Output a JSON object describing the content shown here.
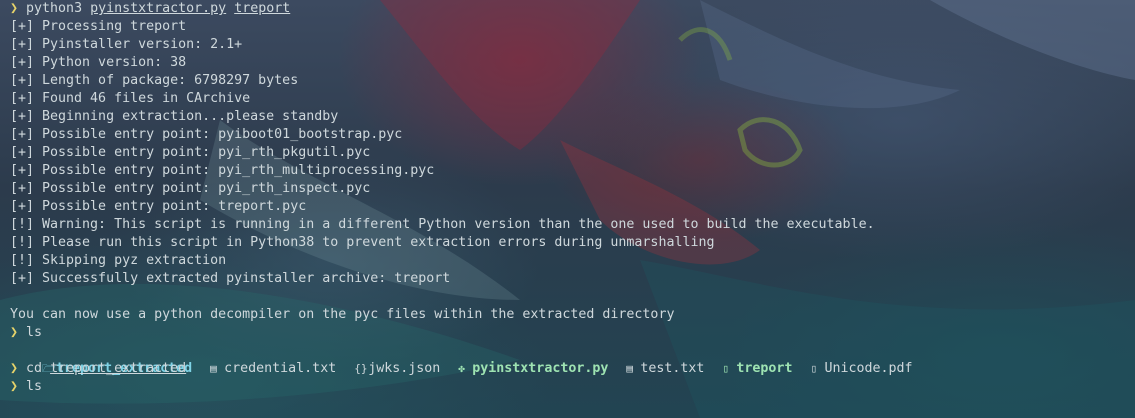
{
  "terminal": {
    "prompt_symbol": "❯",
    "command1": {
      "name": "python3",
      "script": "pyinstxtractor.py",
      "arg": "treport"
    },
    "output_lines": [
      "[+] Processing treport",
      "[+] Pyinstaller version: 2.1+",
      "[+] Python version: 38",
      "[+] Length of package: 6798297 bytes",
      "[+] Found 46 files in CArchive",
      "[+] Beginning extraction...please standby",
      "[+] Possible entry point: pyiboot01_bootstrap.pyc",
      "[+] Possible entry point: pyi_rth_pkgutil.pyc",
      "[+] Possible entry point: pyi_rth_multiprocessing.pyc",
      "[+] Possible entry point: pyi_rth_inspect.pyc",
      "[+] Possible entry point: treport.pyc",
      "[!] Warning: This script is running in a different Python version than the one used to build the executable.",
      "[!] Please run this script in Python38 to prevent extraction errors during unmarshalling",
      "[!] Skipping pyz extraction",
      "[+] Successfully extracted pyinstaller archive: treport",
      "",
      "You can now use a python decompiler on the pyc files within the extracted directory"
    ],
    "command2": {
      "name": "ls"
    },
    "ls_items": [
      {
        "name": "treport_extracted",
        "icon": "folder-icon",
        "glyph": "🗁"
      },
      {
        "name": "credential.txt",
        "icon": "text-file-icon",
        "glyph": "▤"
      },
      {
        "name": "jwks.json",
        "icon": "json-file-icon",
        "glyph": "{}"
      },
      {
        "name": "pyinstxtractor.py",
        "icon": "python-file-icon",
        "glyph": "✤"
      },
      {
        "name": "test.txt",
        "icon": "text-file-icon",
        "glyph": "▤"
      },
      {
        "name": "treport",
        "icon": "executable-file-icon",
        "glyph": "▯"
      },
      {
        "name": "Unicode.pdf",
        "icon": "pdf-file-icon",
        "glyph": "▯"
      }
    ],
    "command3": {
      "name": "cd",
      "arg": "treport_extracted"
    },
    "command4": {
      "name": "ls"
    }
  },
  "colors": {
    "prompt": "#e6d36a",
    "text": "#cfd8dc",
    "directory": "#7fd3e6",
    "executable": "#9ee3b2"
  }
}
